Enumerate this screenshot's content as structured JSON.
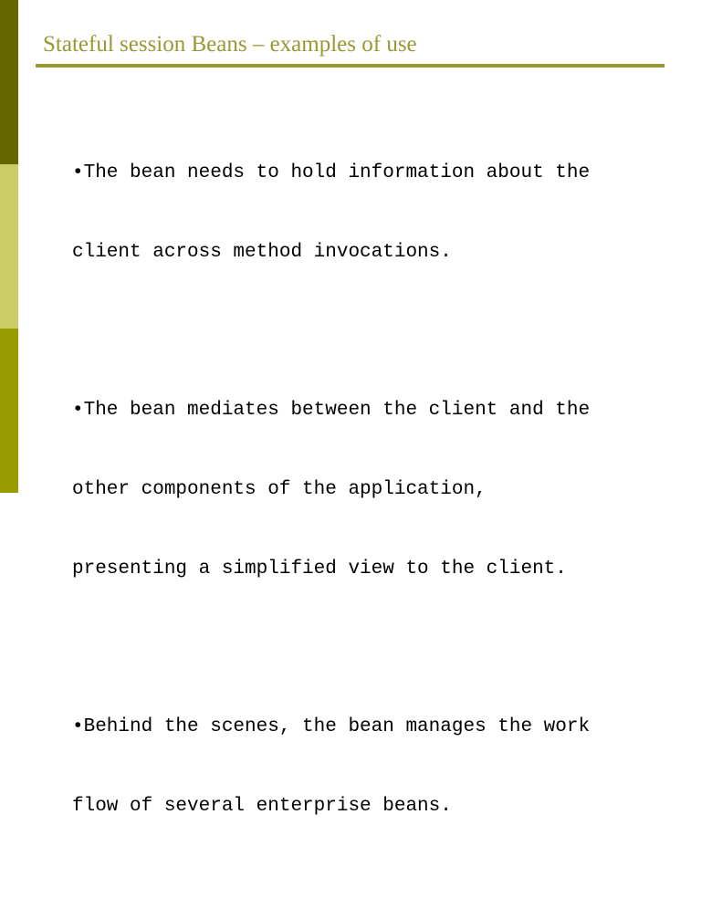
{
  "slide": {
    "title": "Stateful session Beans – examples of use",
    "colors": {
      "sidebar_top": "#666600",
      "sidebar_middle": "#cccc66",
      "sidebar_bottom": "#999900",
      "title": "#999933",
      "body_text": "#000000"
    },
    "bullet_glyph": "•",
    "bullets": [
      {
        "lines": [
          "•The bean needs to hold information about the",
          "client across method invocations."
        ]
      },
      {
        "lines": [
          "•The bean mediates between the client and the",
          "other components of the application,",
          "presenting a simplified view to the client."
        ]
      },
      {
        "lines": [
          "•Behind the scenes, the bean manages the work",
          "flow of several enterprise beans."
        ]
      }
    ]
  }
}
